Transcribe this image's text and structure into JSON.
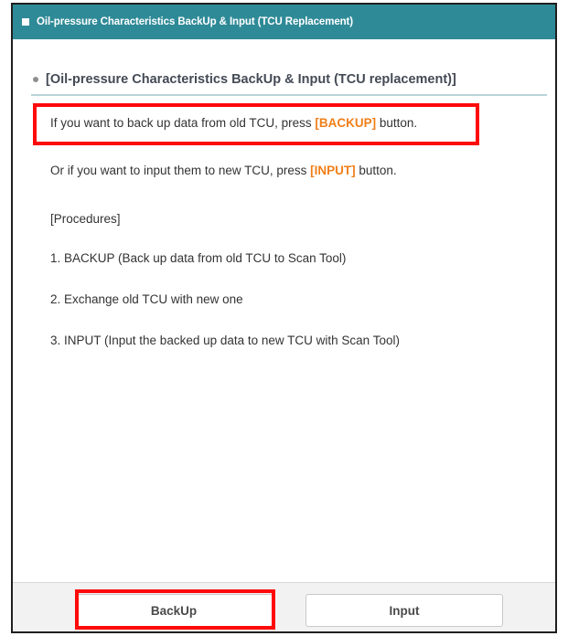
{
  "window": {
    "title": "Oil-pressure Characteristics BackUp & Input (TCU Replacement)"
  },
  "section": {
    "title": "[Oil-pressure Characteristics BackUp & Input (TCU replacement)]"
  },
  "instructions": {
    "line1_prefix": "If you want to back up data from old TCU, press ",
    "line1_keyword": "[BACKUP]",
    "line1_suffix": " button.",
    "line2_prefix": "Or if you want to input them to new TCU, press ",
    "line2_keyword": "[INPUT]",
    "line2_suffix": " button.",
    "procedures_label": "[Procedures]",
    "step1": "1. BACKUP (Back up data from old TCU to Scan Tool)",
    "step2": "2. Exchange old TCU with new one",
    "step3": "3. INPUT (Input the backed up data to new TCU with Scan Tool)"
  },
  "footer": {
    "backup_label": "BackUp",
    "input_label": "Input"
  },
  "colors": {
    "titlebar": "#2f8a97",
    "keyword": "#f07f19",
    "highlight": "#ff0a0a"
  }
}
